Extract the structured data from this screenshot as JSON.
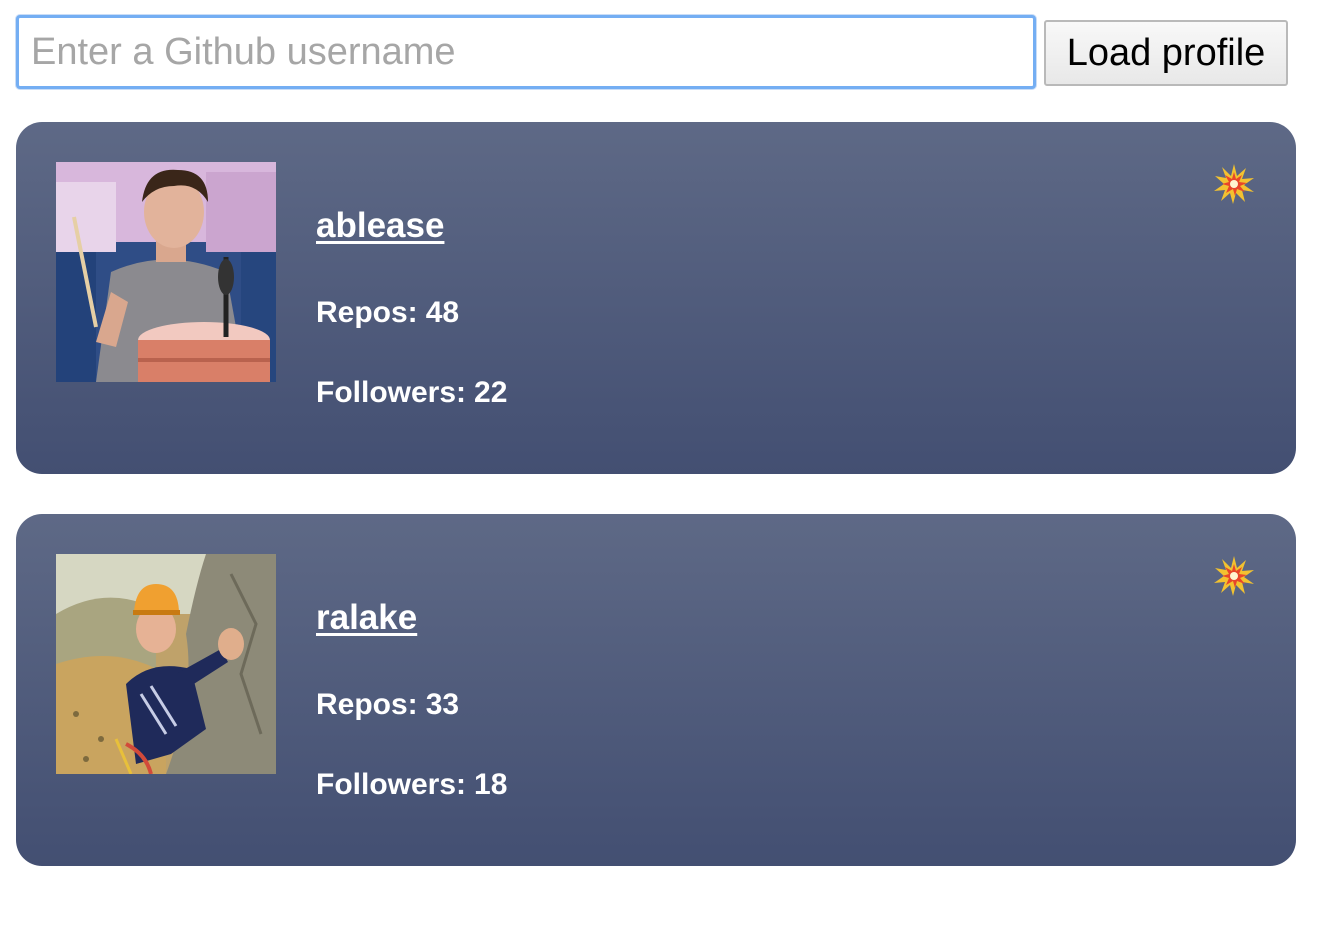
{
  "search": {
    "placeholder": "Enter a Github username",
    "value": "",
    "load_button_label": "Load profile"
  },
  "profiles": [
    {
      "username": "ablease",
      "repos_label": "Repos:",
      "repos": "48",
      "followers_label": "Followers:",
      "followers": "22",
      "avatar_icon": "drummer-avatar-photo",
      "remove_icon": "collision-icon"
    },
    {
      "username": "ralake",
      "repos_label": "Repos:",
      "repos": "33",
      "followers_label": "Followers:",
      "followers": "18",
      "avatar_icon": "climber-avatar-photo",
      "remove_icon": "collision-icon"
    }
  ],
  "colors": {
    "card_gradient_top": "#5e6986",
    "card_gradient_bottom": "#434f72",
    "input_focus_border": "#74aef3"
  }
}
